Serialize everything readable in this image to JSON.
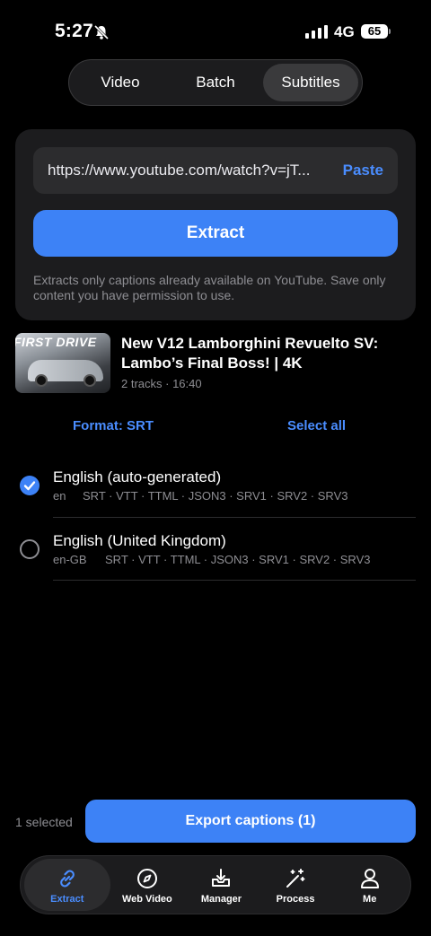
{
  "status_bar": {
    "time": "5:27",
    "network": "4G",
    "battery": "65"
  },
  "segments": [
    {
      "label": "Video",
      "active": false
    },
    {
      "label": "Batch",
      "active": false
    },
    {
      "label": "Subtitles",
      "active": true
    }
  ],
  "input": {
    "url": "https://www.youtube.com/watch?v=jT...",
    "paste_label": "Paste"
  },
  "extract_label": "Extract",
  "note": "Extracts only captions already available on YouTube. Save only content you have permission to use.",
  "video": {
    "thumbnail_text": "FIRST DRIVE",
    "title": "New V12 Lamborghini Revuelto SV: Lambo’s Final Boss! | 4K",
    "meta": "2 tracks · 16:40"
  },
  "format_label": "Format: SRT",
  "select_all_label": "Select all",
  "tracks": [
    {
      "name": "English (auto-generated)",
      "lang": "en",
      "formats": "SRT · VTT · TTML · JSON3 · SRV1 · SRV2 · SRV3",
      "selected": true
    },
    {
      "name": "English (United Kingdom)",
      "lang": "en-GB",
      "formats": "SRT · VTT · TTML · JSON3 · SRV1 · SRV2 · SRV3",
      "selected": false
    }
  ],
  "selection": {
    "count_text": "1 selected",
    "export_label": "Export captions (1)"
  },
  "tabbar": [
    {
      "label": "Extract",
      "icon": "link-icon",
      "active": true
    },
    {
      "label": "Web Video",
      "icon": "compass-icon",
      "active": false
    },
    {
      "label": "Manager",
      "icon": "download-tray-icon",
      "active": false
    },
    {
      "label": "Process",
      "icon": "magic-wand-icon",
      "active": false
    },
    {
      "label": "Me",
      "icon": "person-icon",
      "active": false
    }
  ],
  "colors": {
    "accent": "#3d82f6",
    "link": "#4a8dff",
    "background": "#000000",
    "card": "#1c1c1e"
  }
}
